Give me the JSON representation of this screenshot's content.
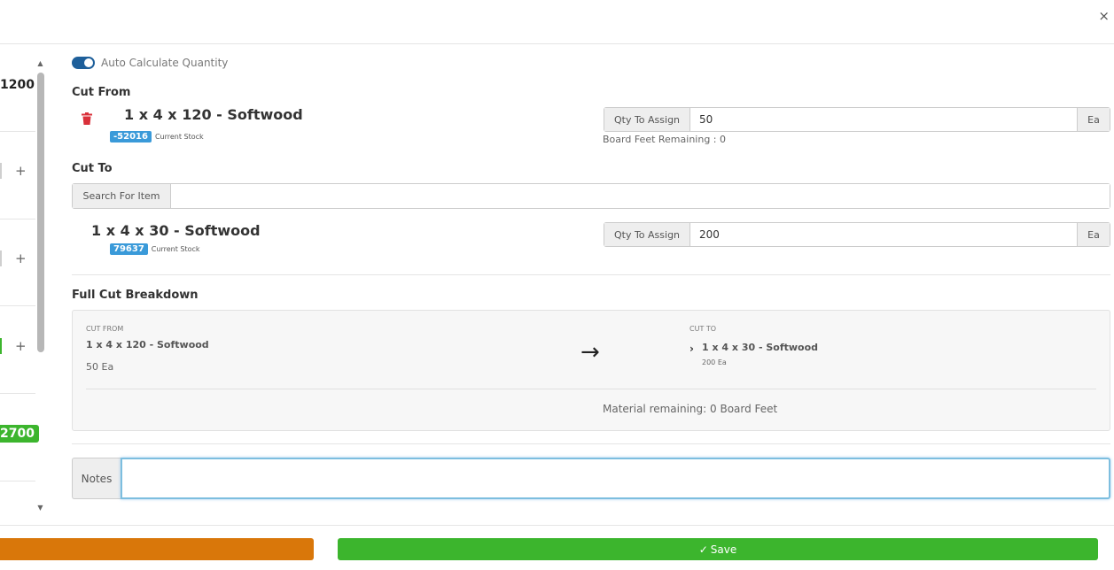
{
  "header": {
    "close_glyph": "×"
  },
  "left_list": {
    "top_value": "1200",
    "plus_glyph": "+",
    "bottom_badge": "2700",
    "scroll_up_glyph": "▲",
    "scroll_down_glyph": "▼"
  },
  "auto_calc": {
    "label": "Auto Calculate Quantity",
    "enabled": true
  },
  "cut_from": {
    "heading": "Cut From",
    "item_name": "1 x 4 x 120 - Softwood",
    "stock_value": "-52016",
    "stock_label": "Current Stock",
    "qty_label": "Qty To Assign",
    "qty_value": "50",
    "unit": "Ea",
    "board_feet_remaining": "Board Feet Remaining : 0",
    "delete_icon": "trash-icon"
  },
  "cut_to": {
    "heading": "Cut To",
    "search_label": "Search For Item",
    "search_value": "",
    "item_name": "1 x 4 x 30 - Softwood",
    "stock_value": "79637",
    "stock_label": "Current Stock",
    "qty_label": "Qty To Assign",
    "qty_value": "200",
    "unit": "Ea"
  },
  "breakdown": {
    "heading": "Full Cut Breakdown",
    "from_label": "CUT FROM",
    "from_item": "1 x 4 x 120 - Softwood",
    "from_qty": "50 Ea",
    "arrow_glyph": "→",
    "to_label": "CUT TO",
    "chevron_glyph": "›",
    "to_item": "1 x 4 x 30 - Softwood",
    "to_qty": "200 Ea",
    "material_remaining": "Material remaining: 0 Board Feet"
  },
  "notes": {
    "label": "Notes",
    "value": ""
  },
  "footer": {
    "save_label": "Save",
    "check_glyph": "✓",
    "orange_button_label": ""
  },
  "colors": {
    "accent_blue": "#1e5f9a",
    "stock_badge": "#3a9ad9",
    "save_green": "#3cb52d",
    "orange": "#d9770a",
    "delete_red": "#d9303a"
  }
}
